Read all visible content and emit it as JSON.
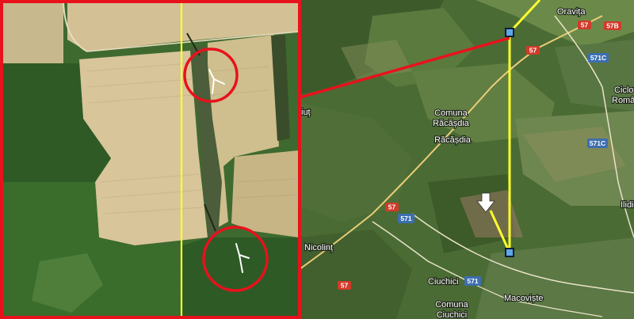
{
  "towns": {
    "oravita": "Oravița",
    "comuna_racasdia_1": "Comuna",
    "comuna_racasdia_2": "Răcășdia",
    "racasdia": "Răcășdia",
    "ciclova_1": "Ciclova",
    "ciclova_2": "Română",
    "iliuț": "iuț",
    "ilidia": "Ilidi",
    "nicolint": "Nicolinț",
    "ciuchici": "Ciuchici",
    "macoviste": "Macoviște",
    "comuna_ciuchici_1": "Comuna",
    "comuna_ciuchici_2": "Ciuchici"
  },
  "roads": {
    "r57_top": "57",
    "r57b": "57B",
    "r57_mid": "57",
    "r571c_top": "571C",
    "r571c_mid": "571C",
    "r57_left": "57",
    "r571_left": "571",
    "r57_bottom": "57",
    "r571_bottom": "571"
  },
  "colors": {
    "frame_red": "#e8121c",
    "yellow_line": "#ffff2e",
    "marker_blue": "#5fa6e6"
  },
  "icons": {
    "arrow": "down-arrow-icon",
    "marker": "square-marker-icon"
  }
}
